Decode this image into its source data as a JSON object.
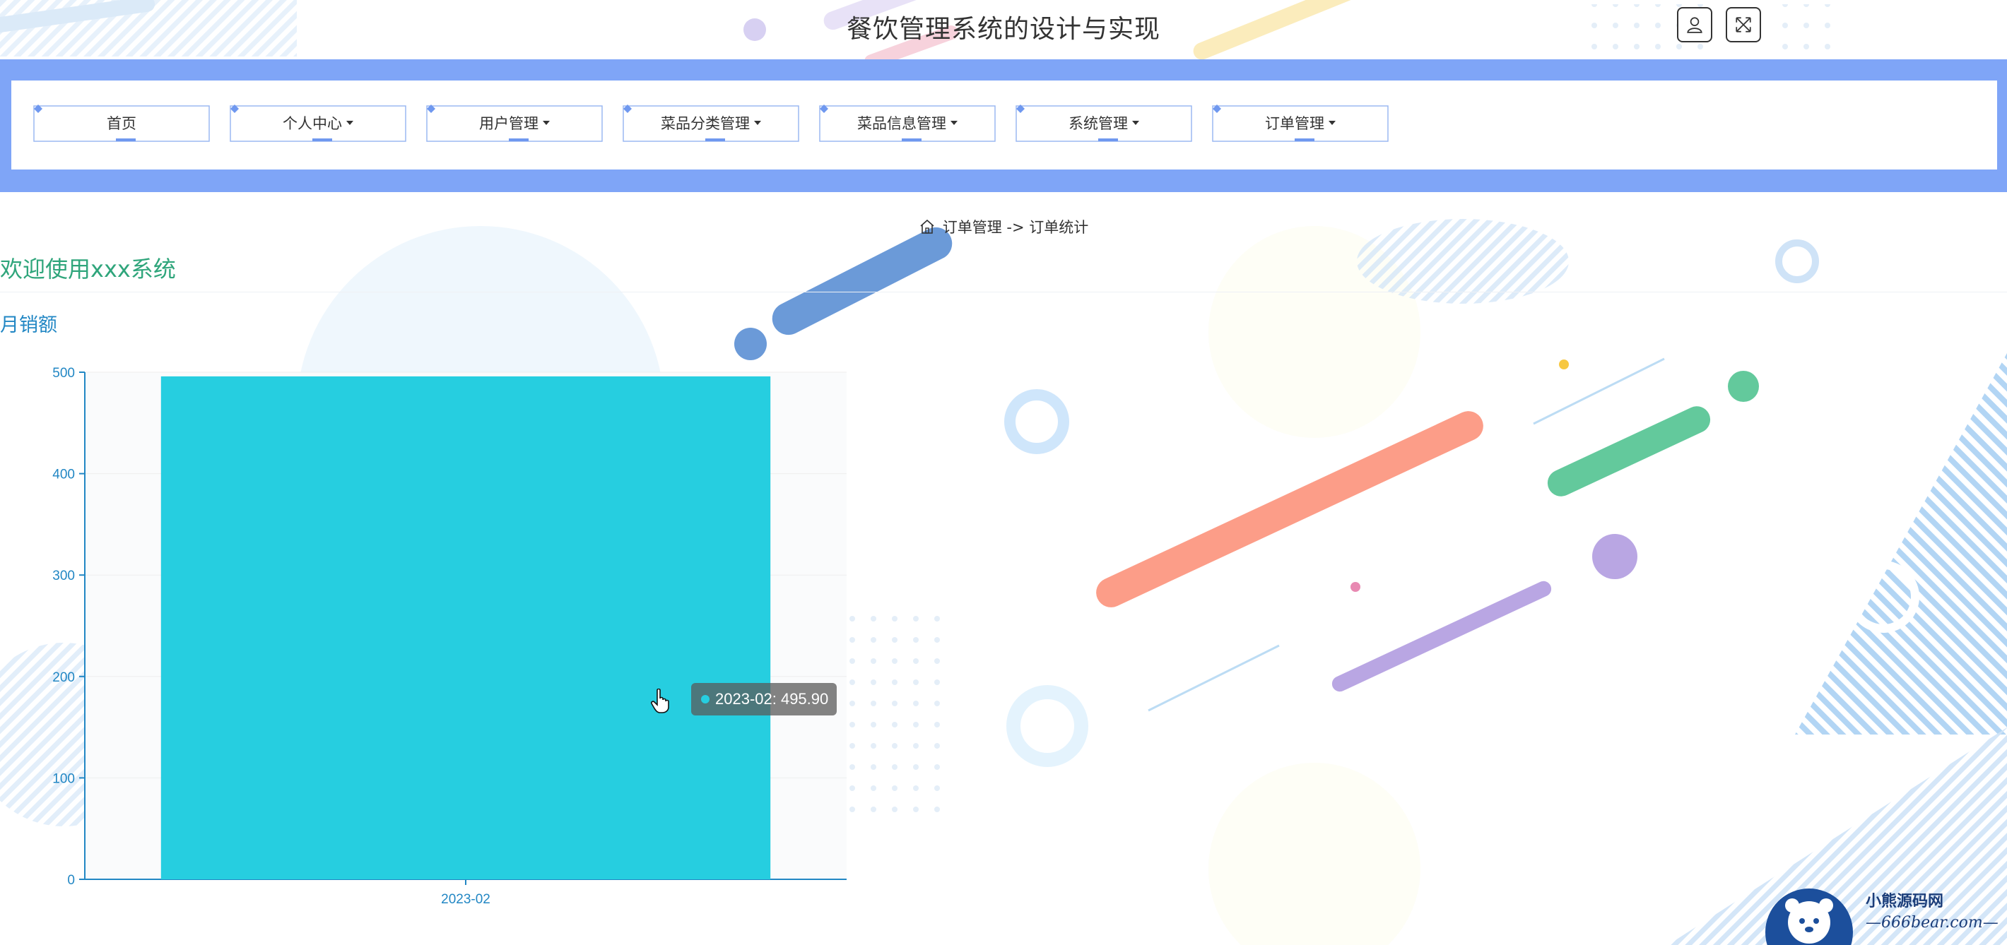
{
  "header": {
    "title": "餐饮管理系统的设计与实现",
    "user_icon": "user-icon",
    "fullscreen_icon": "fullscreen-icon"
  },
  "nav": {
    "items": [
      {
        "label": "首页",
        "dropdown": false
      },
      {
        "label": "个人中心",
        "dropdown": true
      },
      {
        "label": "用户管理",
        "dropdown": true
      },
      {
        "label": "菜品分类管理",
        "dropdown": true
      },
      {
        "label": "菜品信息管理",
        "dropdown": true
      },
      {
        "label": "系统管理",
        "dropdown": true
      },
      {
        "label": "订单管理",
        "dropdown": true
      }
    ]
  },
  "breadcrumb": {
    "parent": "订单管理",
    "separator": "->",
    "current": "订单统计"
  },
  "welcome": "欢迎使用xxx系统",
  "chart_title": "月销额",
  "chart_data": {
    "type": "bar",
    "categories": [
      "2023-02"
    ],
    "values": [
      495.9
    ],
    "ylim": [
      0,
      500
    ],
    "yticks": [
      0,
      100,
      200,
      300,
      400,
      500
    ],
    "bar_color": "#26cee0",
    "axis_color": "#2287c4",
    "grid": true,
    "tooltip": "2023-02: 495.90"
  },
  "watermark": {
    "top": "小熊源码网",
    "bottom": "—666bear.com—"
  },
  "colors": {
    "nav_band": "#7fa5f7",
    "welcome": "#2fa57b",
    "accent": "#2287c4"
  }
}
